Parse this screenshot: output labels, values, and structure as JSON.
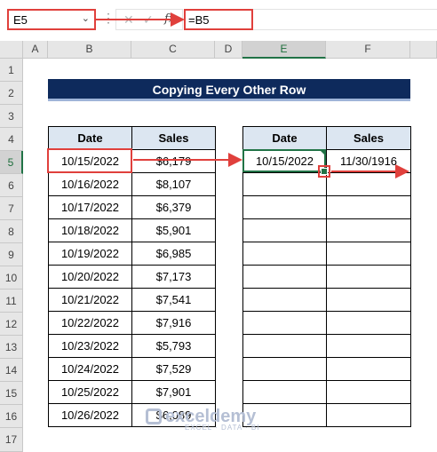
{
  "formula_bar": {
    "name_box": "E5",
    "name_box_arrow": "⌄",
    "dots": "⋮",
    "cancel": "✕",
    "enter": "✓",
    "fx": "fx",
    "formula": "=B5"
  },
  "columns": [
    "A",
    "B",
    "C",
    "D",
    "E",
    "F"
  ],
  "rows": [
    "1",
    "2",
    "3",
    "4",
    "5",
    "6",
    "7",
    "8",
    "9",
    "10",
    "11",
    "12",
    "13",
    "14",
    "15",
    "16",
    "17"
  ],
  "title": "Copying Every Other Row",
  "table1": {
    "headers": [
      "Date",
      "Sales"
    ],
    "rows": [
      [
        "10/15/2022",
        "$6,179"
      ],
      [
        "10/16/2022",
        "$8,107"
      ],
      [
        "10/17/2022",
        "$6,379"
      ],
      [
        "10/18/2022",
        "$5,901"
      ],
      [
        "10/19/2022",
        "$6,985"
      ],
      [
        "10/20/2022",
        "$7,173"
      ],
      [
        "10/21/2022",
        "$7,541"
      ],
      [
        "10/22/2022",
        "$7,916"
      ],
      [
        "10/23/2022",
        "$5,793"
      ],
      [
        "10/24/2022",
        "$7,529"
      ],
      [
        "10/25/2022",
        "$7,901"
      ],
      [
        "10/26/2022",
        "$6,089"
      ]
    ]
  },
  "table2": {
    "headers": [
      "Date",
      "Sales"
    ],
    "rows": [
      [
        "10/15/2022",
        "11/30/1916"
      ],
      [
        "",
        ""
      ],
      [
        "",
        ""
      ],
      [
        "",
        ""
      ],
      [
        "",
        ""
      ],
      [
        "",
        ""
      ],
      [
        "",
        ""
      ],
      [
        "",
        ""
      ],
      [
        "",
        ""
      ],
      [
        "",
        ""
      ],
      [
        "",
        ""
      ],
      [
        "",
        ""
      ]
    ]
  },
  "colors": {
    "title_bg": "#0e2a5c",
    "header_bg": "#dce6f1",
    "highlight": "#e0403c",
    "excel_green": "#217346"
  },
  "watermark": {
    "name": "exceldemy",
    "tagline": "EXCEL · DATA · BI"
  }
}
